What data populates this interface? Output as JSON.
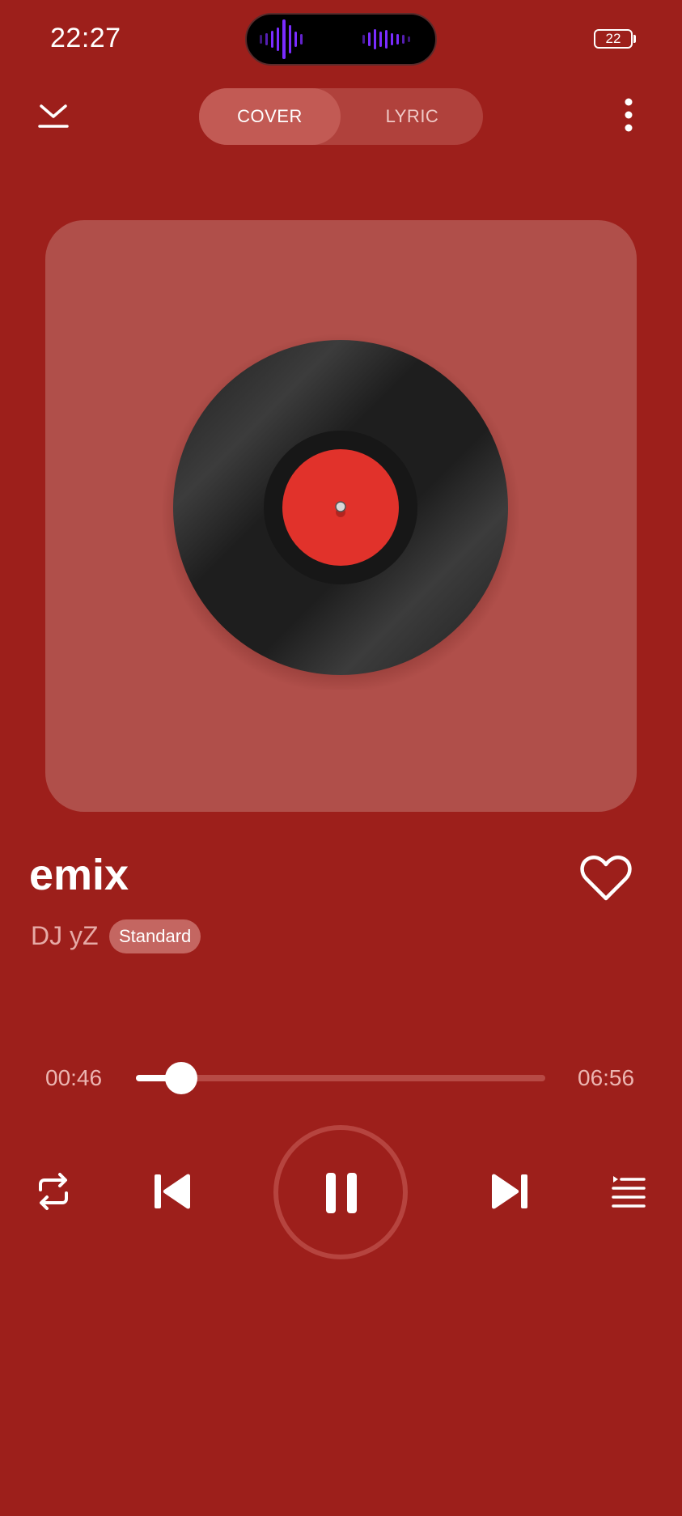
{
  "status_bar": {
    "time": "22:27",
    "battery": "22"
  },
  "header": {
    "tabs": [
      {
        "label": "COVER",
        "active": true
      },
      {
        "label": "LYRIC",
        "active": false
      }
    ]
  },
  "track": {
    "title": "emix",
    "artist": "DJ yZ",
    "quality": "Standard",
    "favorite": false
  },
  "progress": {
    "elapsed": "00:46",
    "total": "06:56",
    "fraction": 0.11
  },
  "controls": {
    "playback_state": "playing",
    "repeat_mode": "repeat"
  },
  "icons": {
    "collapse": "collapse-down-icon",
    "more": "more-vertical-icon",
    "favorite": "heart-icon",
    "repeat": "repeat-icon",
    "previous": "skip-previous-icon",
    "pause": "pause-icon",
    "next": "skip-next-icon",
    "queue": "queue-icon"
  },
  "colors": {
    "background": "#9d1f1b",
    "card": "#b04f4a",
    "vinyl_label": "#e1322b",
    "audio_wave": "#7a2cff"
  }
}
